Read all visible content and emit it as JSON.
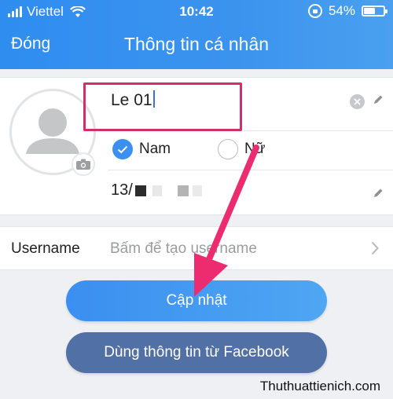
{
  "status_bar": {
    "carrier": "Viettel",
    "time": "10:42",
    "battery": "54%"
  },
  "header": {
    "close_label": "Đóng",
    "title": "Thông tin cá nhân"
  },
  "profile": {
    "name_value": "Le 01",
    "gender_options": [
      "Nam",
      "Nữ"
    ],
    "gender_selected": "Nam",
    "dob_visible": "13/"
  },
  "username": {
    "label": "Username",
    "placeholder": "Bấm để tạo username"
  },
  "buttons": {
    "update": "Cập nhật",
    "facebook": "Dùng thông tin từ Facebook"
  },
  "watermark": "Thuthuattienich.com",
  "colors": {
    "header_blue": "#2f8df0",
    "highlight_red": "#cf2f6a",
    "arrow_pink": "#ec2c6e",
    "facebook_button": "#5170a6"
  },
  "icons": [
    "wifi-icon",
    "rotation-lock-icon",
    "battery-icon",
    "clear-icon",
    "pencil-icon",
    "camera-icon",
    "checkmark-icon",
    "chevron-right-icon"
  ]
}
